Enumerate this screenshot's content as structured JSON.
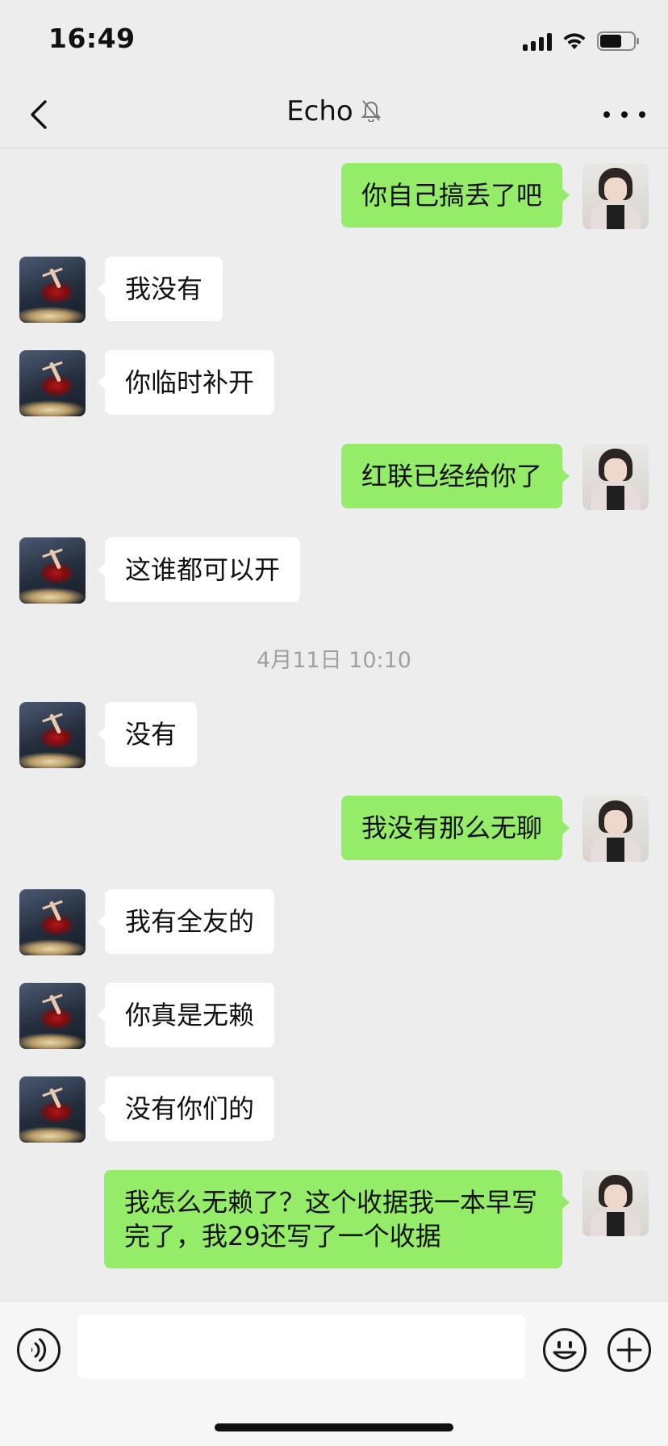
{
  "status_bar": {
    "time": "16:49"
  },
  "nav": {
    "title": "Echo"
  },
  "messages": [
    {
      "side": "out",
      "text": "你自己搞丢了吧"
    },
    {
      "side": "in",
      "text": "我没有"
    },
    {
      "side": "in",
      "text": "你临时补开"
    },
    {
      "side": "out",
      "text": "红联已经给你了"
    },
    {
      "side": "in",
      "text": "这谁都可以开"
    },
    {
      "side": "in",
      "text": "没有"
    },
    {
      "side": "out",
      "text": "我没有那么无聊"
    },
    {
      "side": "in",
      "text": "我有全友的"
    },
    {
      "side": "in",
      "text": "你真是无赖"
    },
    {
      "side": "in",
      "text": "没有你们的"
    },
    {
      "side": "out",
      "text": "我怎么无赖了？这个收据我一本早写完了，我29还写了一个收据"
    }
  ],
  "timestamp": "4月11日 10:10",
  "input": {
    "value": "",
    "placeholder": ""
  },
  "icons": {
    "back": "chevron-left-icon",
    "mute": "bell-off-icon",
    "more": "more-horizontal-icon",
    "voice": "voice-icon",
    "emoji": "emoji-icon",
    "plus": "plus-circle-icon"
  },
  "colors": {
    "outgoing_bubble": "#95ec69",
    "incoming_bubble": "#ffffff",
    "background": "#ededed"
  }
}
